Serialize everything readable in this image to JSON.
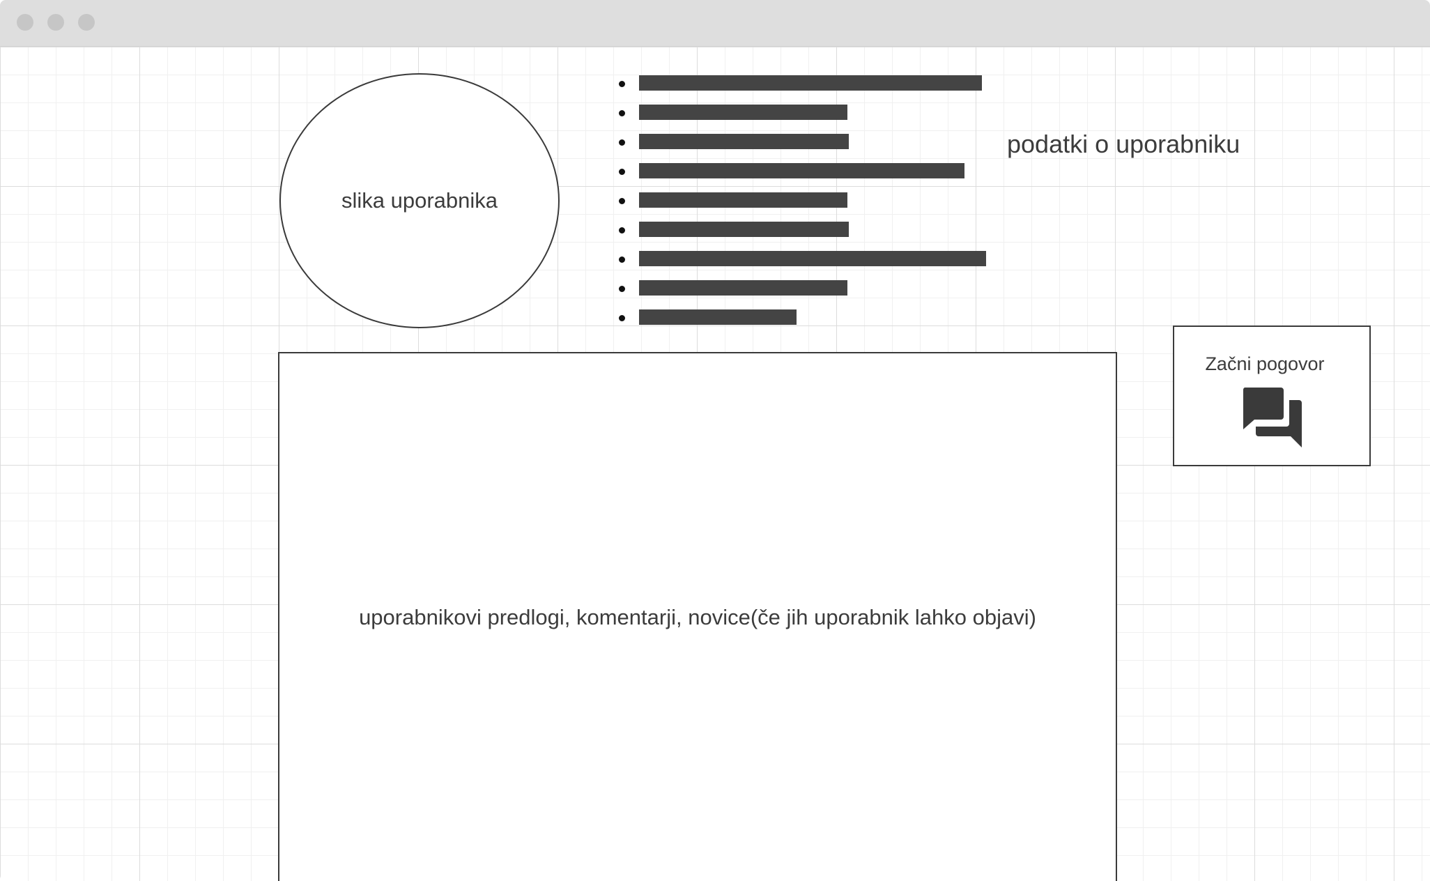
{
  "window": {
    "traffic_lights": [
      "close",
      "minimize",
      "zoom"
    ],
    "dot_color": "#c6c6c6",
    "titlebar_color": "#dedede"
  },
  "profile": {
    "avatar_label": "slika uporabnika",
    "info_label": "podatki o uporabniku",
    "info_items_count": 9,
    "bar_color": "#444444"
  },
  "posts": {
    "label": "uporabnikovi predlogi, komentarji, novice(če jih uporabnik lahko objavi)"
  },
  "chat": {
    "button_label": "Začni pogovor",
    "icon": "chat-bubbles-icon"
  }
}
